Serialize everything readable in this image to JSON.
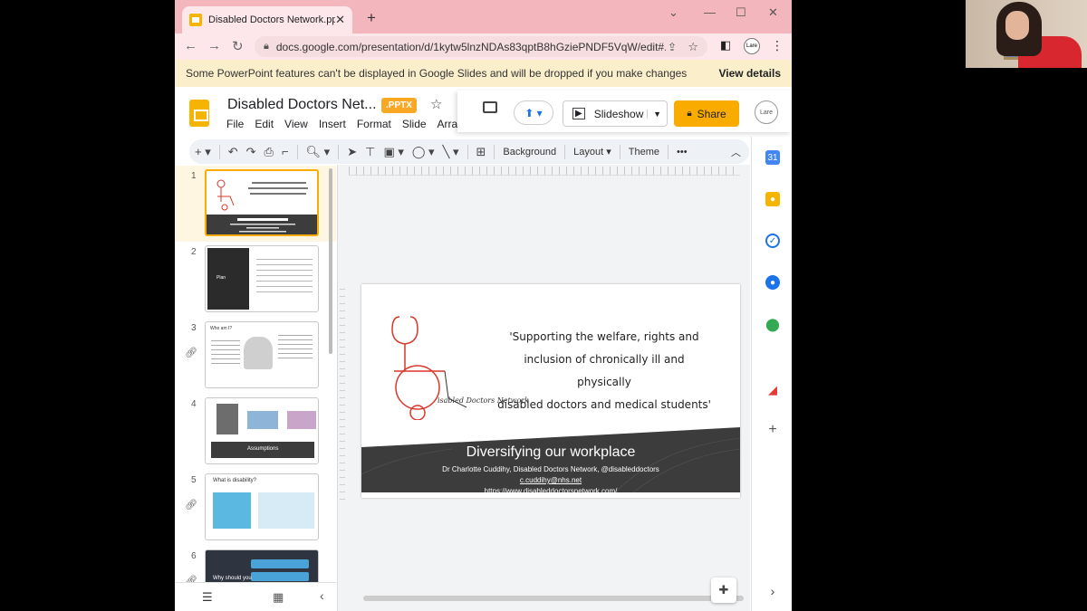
{
  "browser": {
    "tab_title": "Disabled Doctors Network.pptx -",
    "url": "docs.google.com/presentation/d/1kytw5lnzNDAs83qptB8hGziePNDF5VqW/edit#...",
    "banner_text": "Some PowerPoint features can't be displayed in Google Slides and will be dropped if you make changes",
    "banner_action": "View details",
    "avatar_label": "Lare"
  },
  "app": {
    "doc_title": "Disabled Doctors Net...",
    "badge": ".PPTX",
    "menu": [
      "File",
      "Edit",
      "View",
      "Insert",
      "Format",
      "Slide",
      "Arran"
    ],
    "slideshow_label": "Slideshow",
    "share_label": "Share",
    "account_label": "Lare"
  },
  "toolbar": {
    "background_label": "Background",
    "layout_label": "Layout",
    "theme_label": "Theme",
    "more_label": "•••"
  },
  "filmstrip": {
    "slides": [
      {
        "num": "1",
        "title": "Diversifying our workplace"
      },
      {
        "num": "2",
        "title": "Plan"
      },
      {
        "num": "3",
        "title": "Who am I?"
      },
      {
        "num": "4",
        "title": "Assumptions"
      },
      {
        "num": "5",
        "title": "What is disability?"
      },
      {
        "num": "6",
        "title": "Why should you"
      }
    ]
  },
  "slide": {
    "quote_line1": "'Supporting the welfare, rights and",
    "quote_line2": "inclusion of chronically ill and physically",
    "quote_line3": "disabled doctors and medical students'",
    "logo_text": "isabled Doctors Network",
    "heading": "Diversifying our workplace",
    "subtitle": "Dr Charlotte Cuddihy, Disabled Doctors Network, @disableddoctors",
    "email": "c.cuddihy@nhs.net",
    "website": "https://www.disableddoctorsnetwork.com/"
  },
  "colors": {
    "tabstrip": "#f2b6bc",
    "banner": "#fbefcb",
    "accent": "#f9ab00",
    "slide_band": "#3c3c3c",
    "stethoscope": "#d9372b"
  }
}
